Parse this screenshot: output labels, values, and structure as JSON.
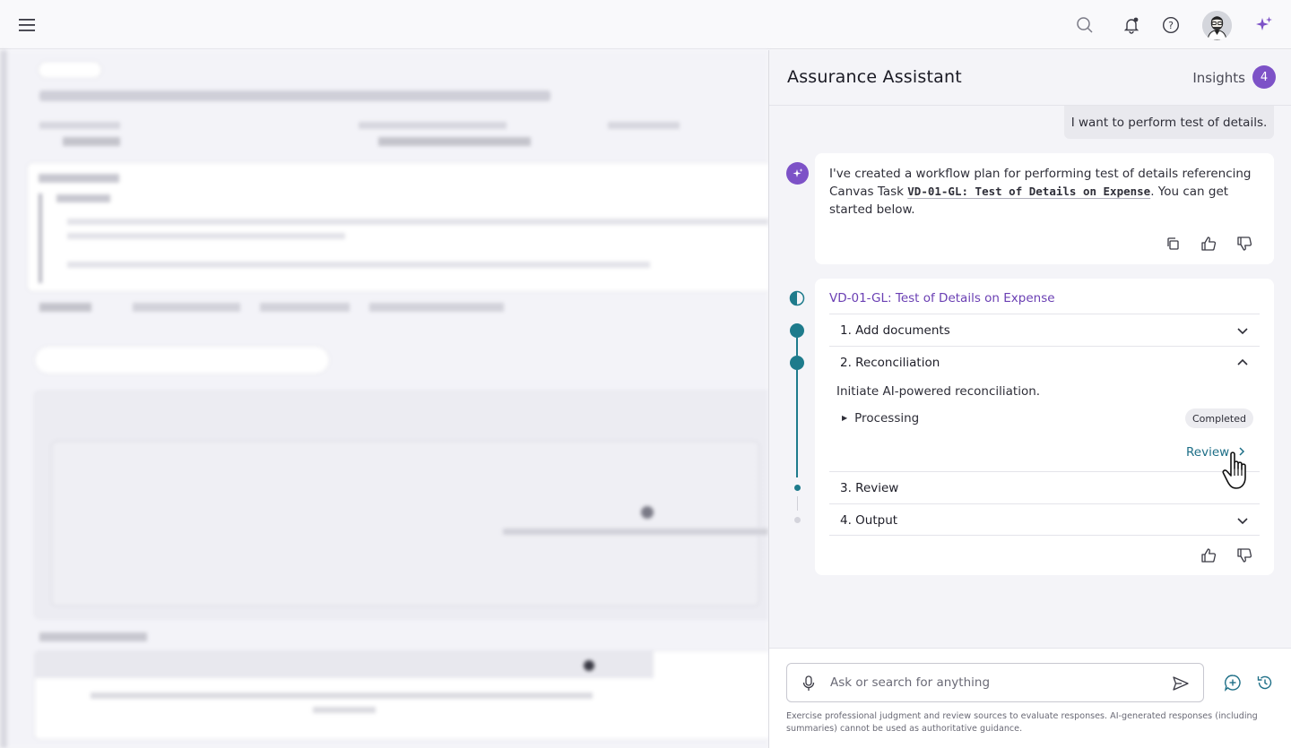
{
  "topbar": {
    "icons": [
      "menu-icon",
      "search-icon",
      "bell-icon",
      "help-icon",
      "avatar",
      "sparkle-icon"
    ]
  },
  "assistant": {
    "title": "Assurance Assistant",
    "insights_label": "Insights",
    "insights_count": "4",
    "user_message": "I want to perform test of details.",
    "ai_message": {
      "prefix": "I've created a workflow plan for performing test of details referencing Canvas Task ",
      "task_ref": "VD-01-GL: Test of Details on Expense",
      "suffix": ". You can get started below."
    },
    "workflow": {
      "title": "VD-01-GL: Test of Details on Expense",
      "steps": [
        {
          "label": "1.  Add documents",
          "state": "collapsed"
        },
        {
          "label": "2. Reconciliation",
          "state": "expanded"
        },
        {
          "label": "3. Review",
          "state": "none"
        },
        {
          "label": "4. Output",
          "state": "collapsed"
        }
      ],
      "reconciliation": {
        "description": "Initiate AI-powered reconciliation.",
        "sub_item": "Processing",
        "status": "Completed",
        "action": "Review"
      }
    },
    "input": {
      "placeholder": "Ask or search for anything"
    },
    "disclaimer": "Exercise professional judgment and review sources to evaluate responses. AI-generated responses (including summaries) cannot be used as authoritative guidance."
  },
  "colors": {
    "accent_purple": "#7d52c7",
    "link_purple": "#6a3fb3",
    "teal": "#1e7b8c",
    "review_link": "#1e6f87"
  }
}
